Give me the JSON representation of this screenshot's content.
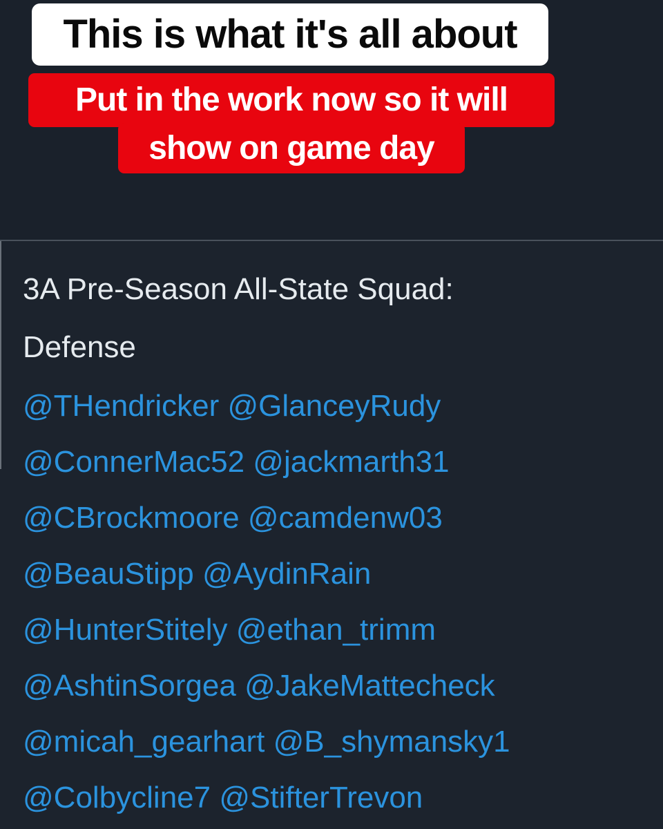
{
  "overlay": {
    "headline": "This is what it's all about",
    "subline_1": "Put in the work now so it will",
    "subline_2": "show on game day"
  },
  "tweet": {
    "title_line_1": "3A Pre-Season All-State Squad:",
    "title_line_2": "Defense",
    "mention_rows": [
      [
        "@THendricker",
        "@GlanceyRudy"
      ],
      [
        "@ConnerMac52",
        "@jackmarth31"
      ],
      [
        "@CBrockmoore",
        "@camdenw03"
      ],
      [
        "@BeauStipp",
        "@AydinRain"
      ],
      [
        "@HunterStitely",
        "@ethan_trimm"
      ],
      [
        "@AshtinSorgea",
        "@JakeMattecheck"
      ],
      [
        "@micah_gearhart",
        "@B_shymansky1"
      ],
      [
        "@Colbycline7",
        "@StifterTrevon"
      ]
    ]
  },
  "colors": {
    "background": "#1c232d",
    "headline_bg": "#ffffff",
    "subline_bg": "#e8050f",
    "mention": "#2b93de",
    "text": "#e6ebef"
  }
}
